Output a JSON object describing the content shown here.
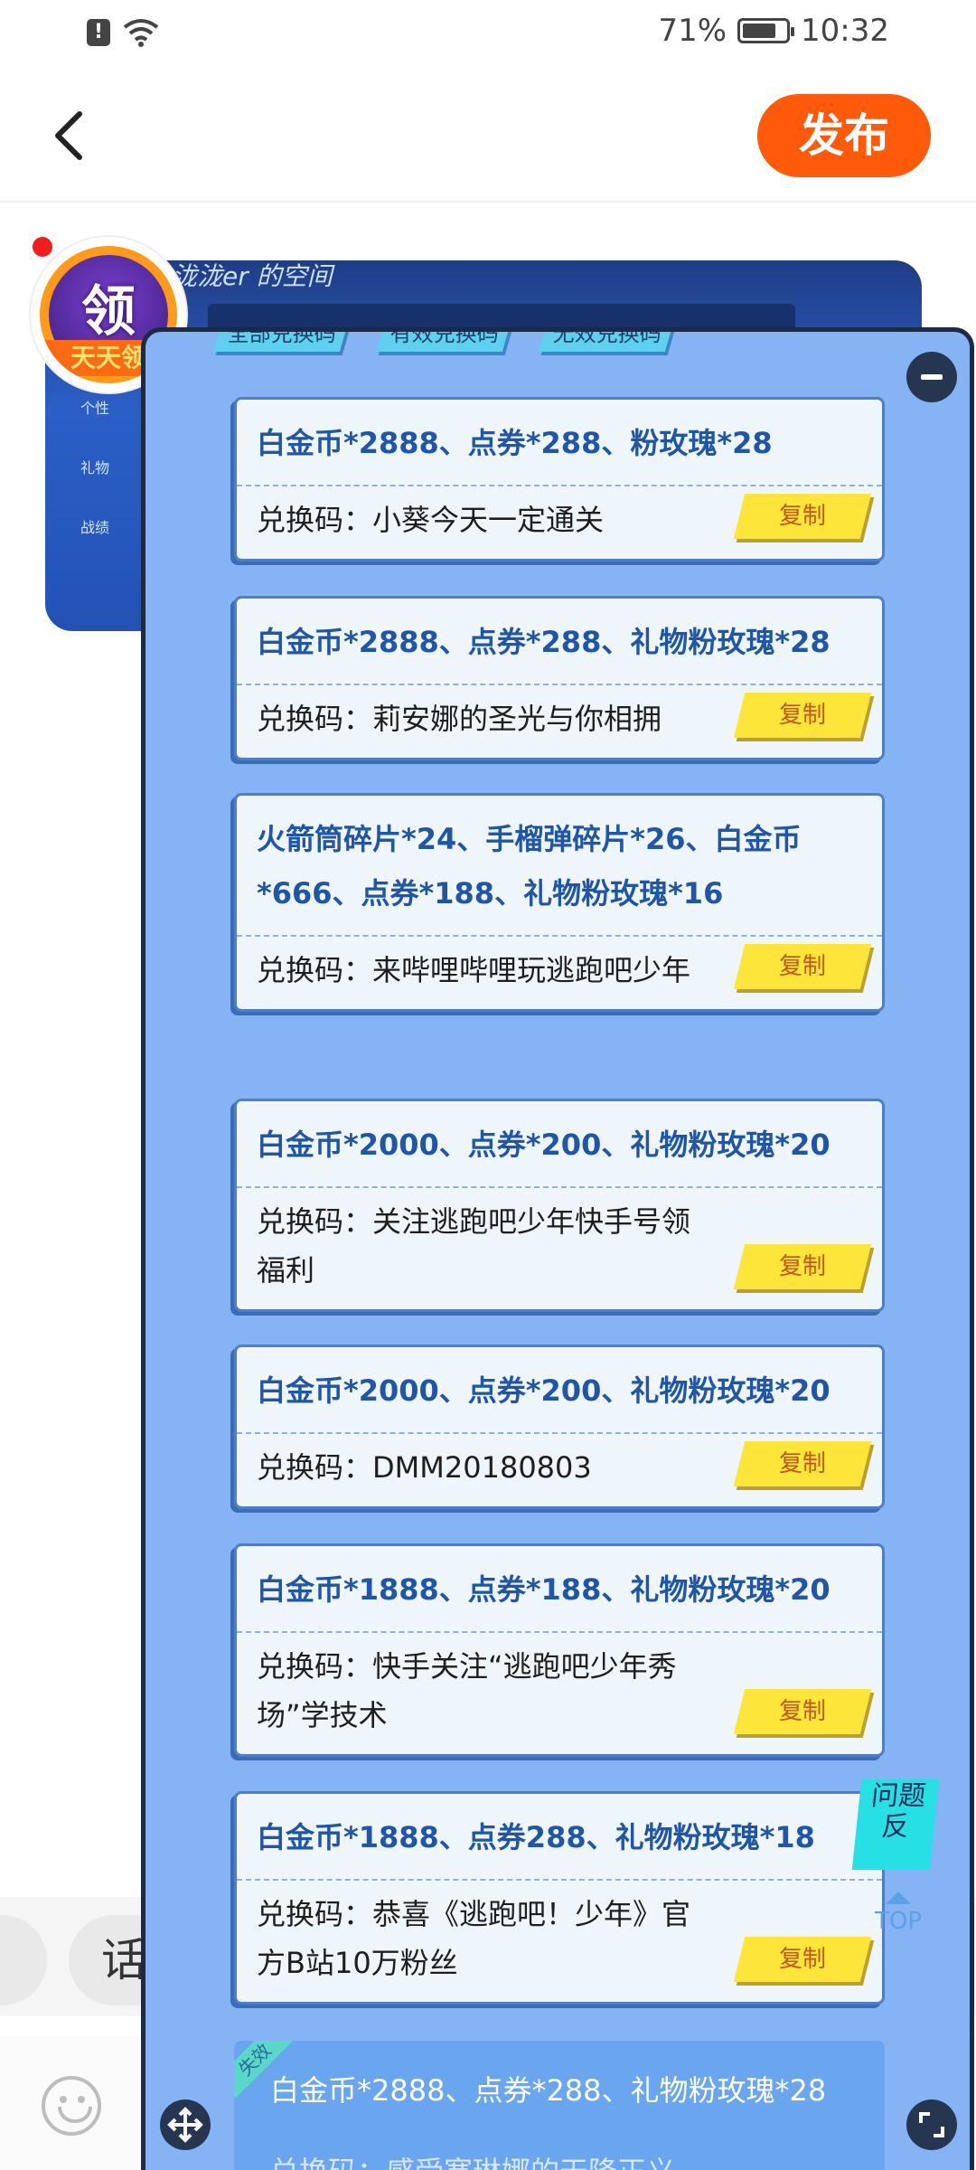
{
  "status_bar": {
    "battery": "71%",
    "time": "10:32"
  },
  "header": {
    "publish_label": "发布"
  },
  "banner": {
    "space_title": "泷泷er 的空间",
    "nav": [
      "个性",
      "礼物",
      "战绩"
    ]
  },
  "avatar": {
    "char": "领",
    "ribbon": "天天领"
  },
  "overlay": {
    "tabs": [
      "全部兑换码",
      "有效兑换码",
      "无效兑换码"
    ],
    "code_prefix": "兑换码：",
    "copy_label": "复制",
    "cards": [
      {
        "title": "白金币*2888、点券*288、粉玫瑰*28",
        "code": "小葵今天一定通关"
      },
      {
        "title": "白金币*2888、点券*288、礼物粉玫瑰*28",
        "code": "莉安娜的圣光与你相拥"
      },
      {
        "title": "火箭筒碎片*24、手榴弹碎片*26、白金币*666、点券*188、礼物粉玫瑰*16",
        "code": "来哔哩哔哩玩逃跑吧少年"
      },
      {
        "title": "白金币*2000、点券*200、礼物粉玫瑰*20",
        "code": "关注逃跑吧少年快手号领福利"
      },
      {
        "title": "白金币*2000、点券*200、礼物粉玫瑰*20",
        "code": "DMM20180803"
      },
      {
        "title": "白金币*1888、点券*188、礼物粉玫瑰*20",
        "code": "快手关注“逃跑吧少年秀场”学技术"
      },
      {
        "title": "白金币*1888、点券288、礼物粉玫瑰*18",
        "code": "恭喜《逃跑吧！少年》官方B站10万粉丝"
      }
    ],
    "expired": {
      "tag": "失效",
      "title": "白金币*2888、点券*288、礼物粉玫瑰*28",
      "code_line": "兑换码：感受塞琳娜的天降正义"
    },
    "feedback_label": "问题反",
    "top_label": "TOP"
  },
  "input_hint": "话"
}
